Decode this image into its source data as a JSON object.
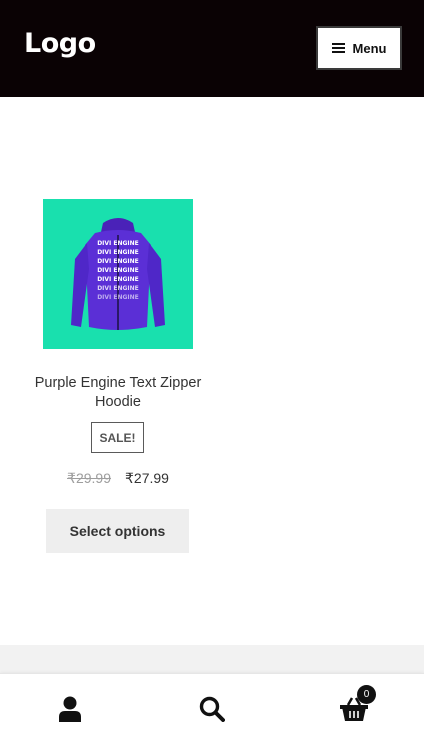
{
  "header": {
    "logo": "Logo",
    "menu_label": "Menu"
  },
  "product": {
    "title": "Purple Engine Text Zipper Hoodie",
    "badge": "SALE!",
    "price_old": "₹29.99",
    "price_new": "₹27.99",
    "button_label": "Select options",
    "image_text_lines": [
      "DIVI ENGINE",
      "DIVI ENGINE",
      "DIVI ENGINE",
      "DIVI ENGINE",
      "DIVI ENGINE",
      "DIVI ENGINE",
      "DIVI ENGINE"
    ]
  },
  "bottom_bar": {
    "account_icon": "user-icon",
    "search_icon": "search-icon",
    "cart_icon": "basket-icon",
    "cart_count": "0"
  },
  "colors": {
    "header_bg": "#0a0204",
    "product_bg": "#19e0ae",
    "hoodie": "#5b2fd6"
  }
}
